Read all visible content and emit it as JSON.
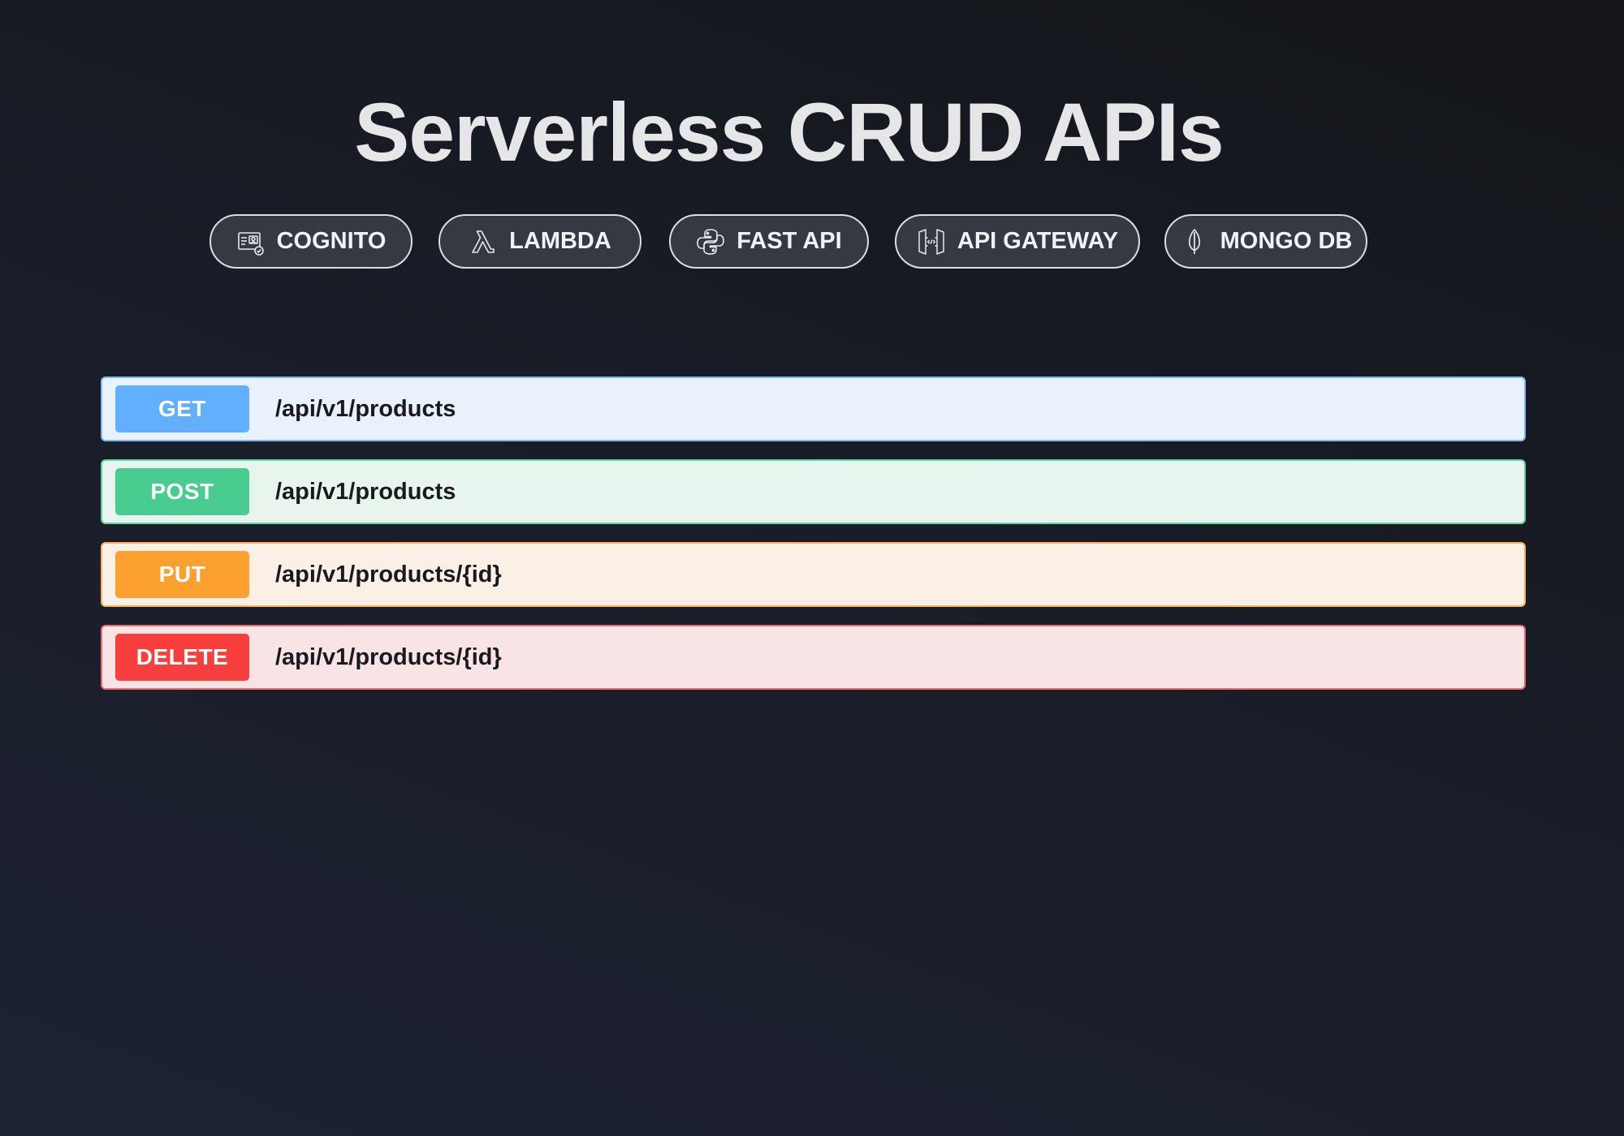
{
  "header": {
    "title": "Serverless CRUD APIs"
  },
  "badges": [
    {
      "label": "COGNITO",
      "icon": "cognito-icon"
    },
    {
      "label": "LAMBDA",
      "icon": "lambda-icon"
    },
    {
      "label": "FAST API",
      "icon": "python-icon"
    },
    {
      "label": "API GATEWAY",
      "icon": "api-gateway-icon"
    },
    {
      "label": "MONGO DB",
      "icon": "mongodb-leaf-icon"
    }
  ],
  "endpoints": [
    {
      "method": "GET",
      "path": "/api/v1/products",
      "color": "#61affe"
    },
    {
      "method": "POST",
      "path": "/api/v1/products",
      "color": "#49cc90"
    },
    {
      "method": "PUT",
      "path": "/api/v1/products/{id}",
      "color": "#fca130"
    },
    {
      "method": "DELETE",
      "path": "/api/v1/products/{id}",
      "color": "#f93e3e"
    }
  ],
  "colors": {
    "background": "#191d27",
    "badge_bg": "#353941",
    "badge_border": "#dcdde0"
  }
}
